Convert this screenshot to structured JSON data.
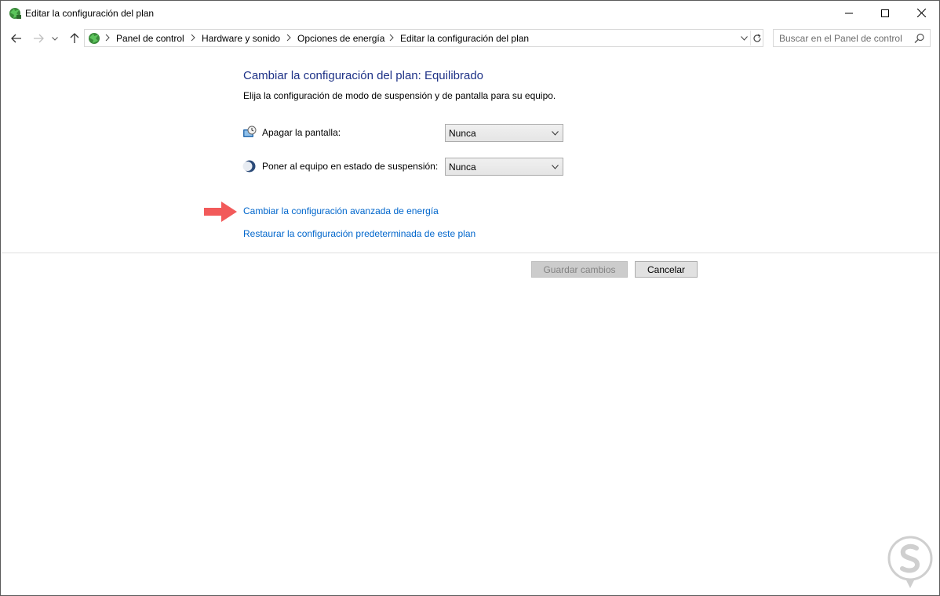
{
  "window": {
    "title": "Editar la configuración del plan"
  },
  "breadcrumb": [
    "Panel de control",
    "Hardware y sonido",
    "Opciones de energía",
    "Editar la configuración del plan"
  ],
  "search": {
    "placeholder": "Buscar en el Panel de control"
  },
  "main": {
    "heading": "Cambiar la configuración del plan: Equilibrado",
    "subtitle": "Elija la configuración de modo de suspensión y de pantalla para su equipo.",
    "settings": [
      {
        "label": "Apagar la pantalla:",
        "value": "Nunca",
        "icon": "monitor-clock-icon"
      },
      {
        "label": "Poner al equipo en estado de suspensión:",
        "value": "Nunca",
        "icon": "moon-icon"
      }
    ],
    "links": {
      "advanced": "Cambiar la configuración avanzada de energía",
      "restore": "Restaurar la configuración predeterminada de este plan"
    },
    "buttons": {
      "save": "Guardar cambios",
      "cancel": "Cancelar"
    }
  },
  "colors": {
    "heading": "#1e3287",
    "link": "#0066cc",
    "arrow": "#f25a5a"
  }
}
